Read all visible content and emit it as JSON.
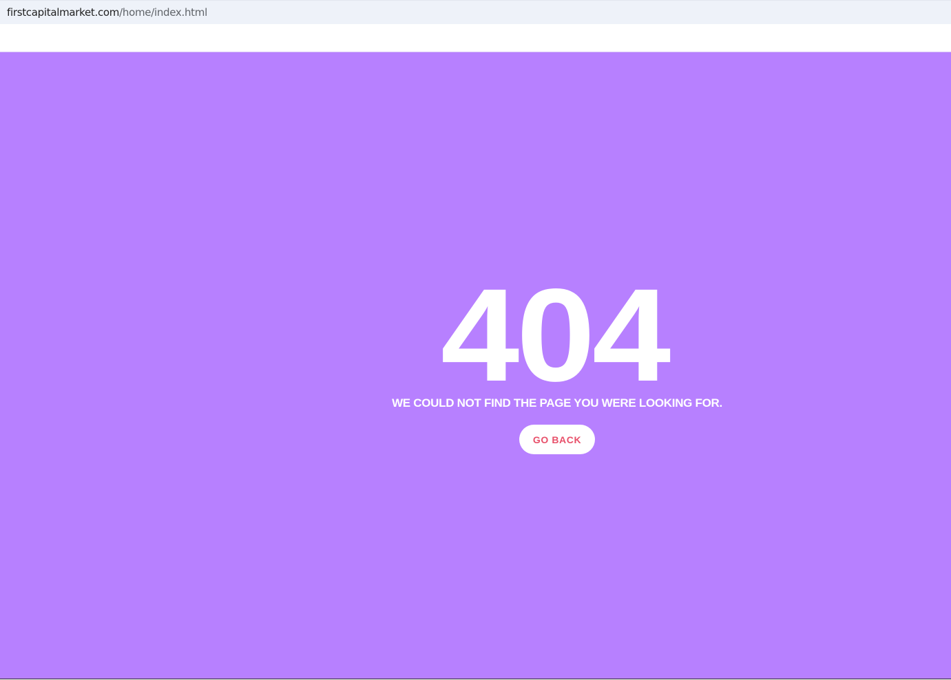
{
  "browser": {
    "url_domain": "firstcapitalmarket.com",
    "url_path": "/home/index.html"
  },
  "error_page": {
    "code": "404",
    "message": "WE COULD NOT FIND THE PAGE YOU WERE LOOKING FOR.",
    "button_label": "GO BACK"
  },
  "colors": {
    "background": "#b780ff",
    "text": "#ffffff",
    "button_text": "#e8506a",
    "address_bar": "#eef2f9"
  }
}
